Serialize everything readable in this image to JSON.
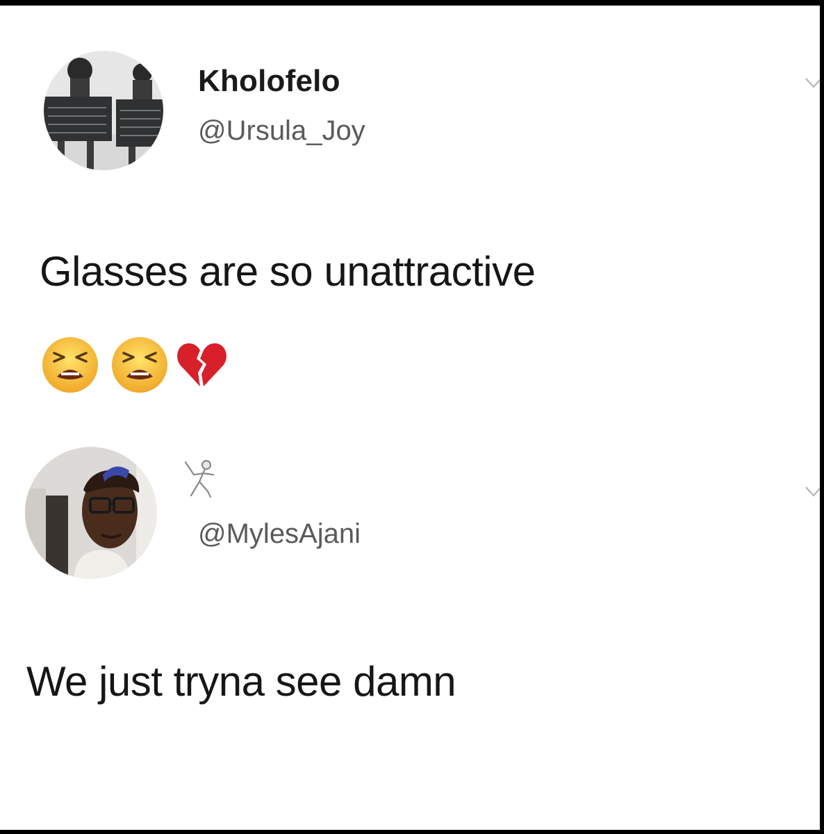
{
  "tweets": [
    {
      "display_name": "Kholofelo",
      "handle": "@Ursula_Joy",
      "text": "Glasses are so unattractive",
      "emojis": [
        "tired-face-emoji",
        "tired-face-emoji",
        "broken-heart-emoji"
      ],
      "menu_icon": "chevron-down-icon"
    },
    {
      "display_name_emoji": "fencer-emoji",
      "handle": "@MylesAjani",
      "text": "We just tryna see damn",
      "menu_icon": "chevron-down-icon"
    }
  ],
  "colors": {
    "background": "#ffffff",
    "frame": "#000000",
    "name_text": "#1a1a1a",
    "handle_text": "#5a5a5a",
    "body_text": "#161616"
  }
}
